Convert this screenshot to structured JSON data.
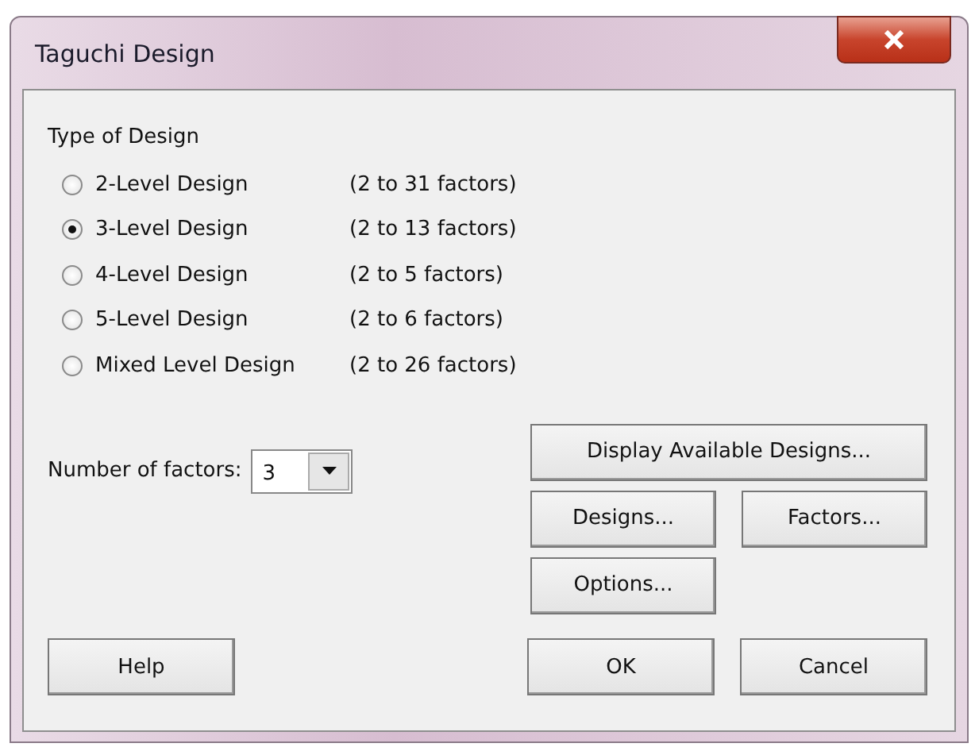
{
  "window": {
    "title": "Taguchi Design"
  },
  "design_type": {
    "label": "Type of Design",
    "options": [
      {
        "label": "2-Level Design",
        "range": "(2 to 31 factors)",
        "selected": false
      },
      {
        "label": "3-Level Design",
        "range": "(2 to 13 factors)",
        "selected": true
      },
      {
        "label": "4-Level Design",
        "range": "(2 to 5 factors)",
        "selected": false
      },
      {
        "label": "5-Level Design",
        "range": "(2 to 6 factors)",
        "selected": false
      },
      {
        "label": "Mixed Level Design",
        "range": "(2 to 26 factors)",
        "selected": false
      }
    ]
  },
  "number_of_factors": {
    "label": "Number of factors:",
    "value": "3"
  },
  "buttons": {
    "display": "Display Available Designs...",
    "designs": "Designs...",
    "factors": "Factors...",
    "options": "Options...",
    "help": "Help",
    "ok": "OK",
    "cancel": "Cancel"
  }
}
